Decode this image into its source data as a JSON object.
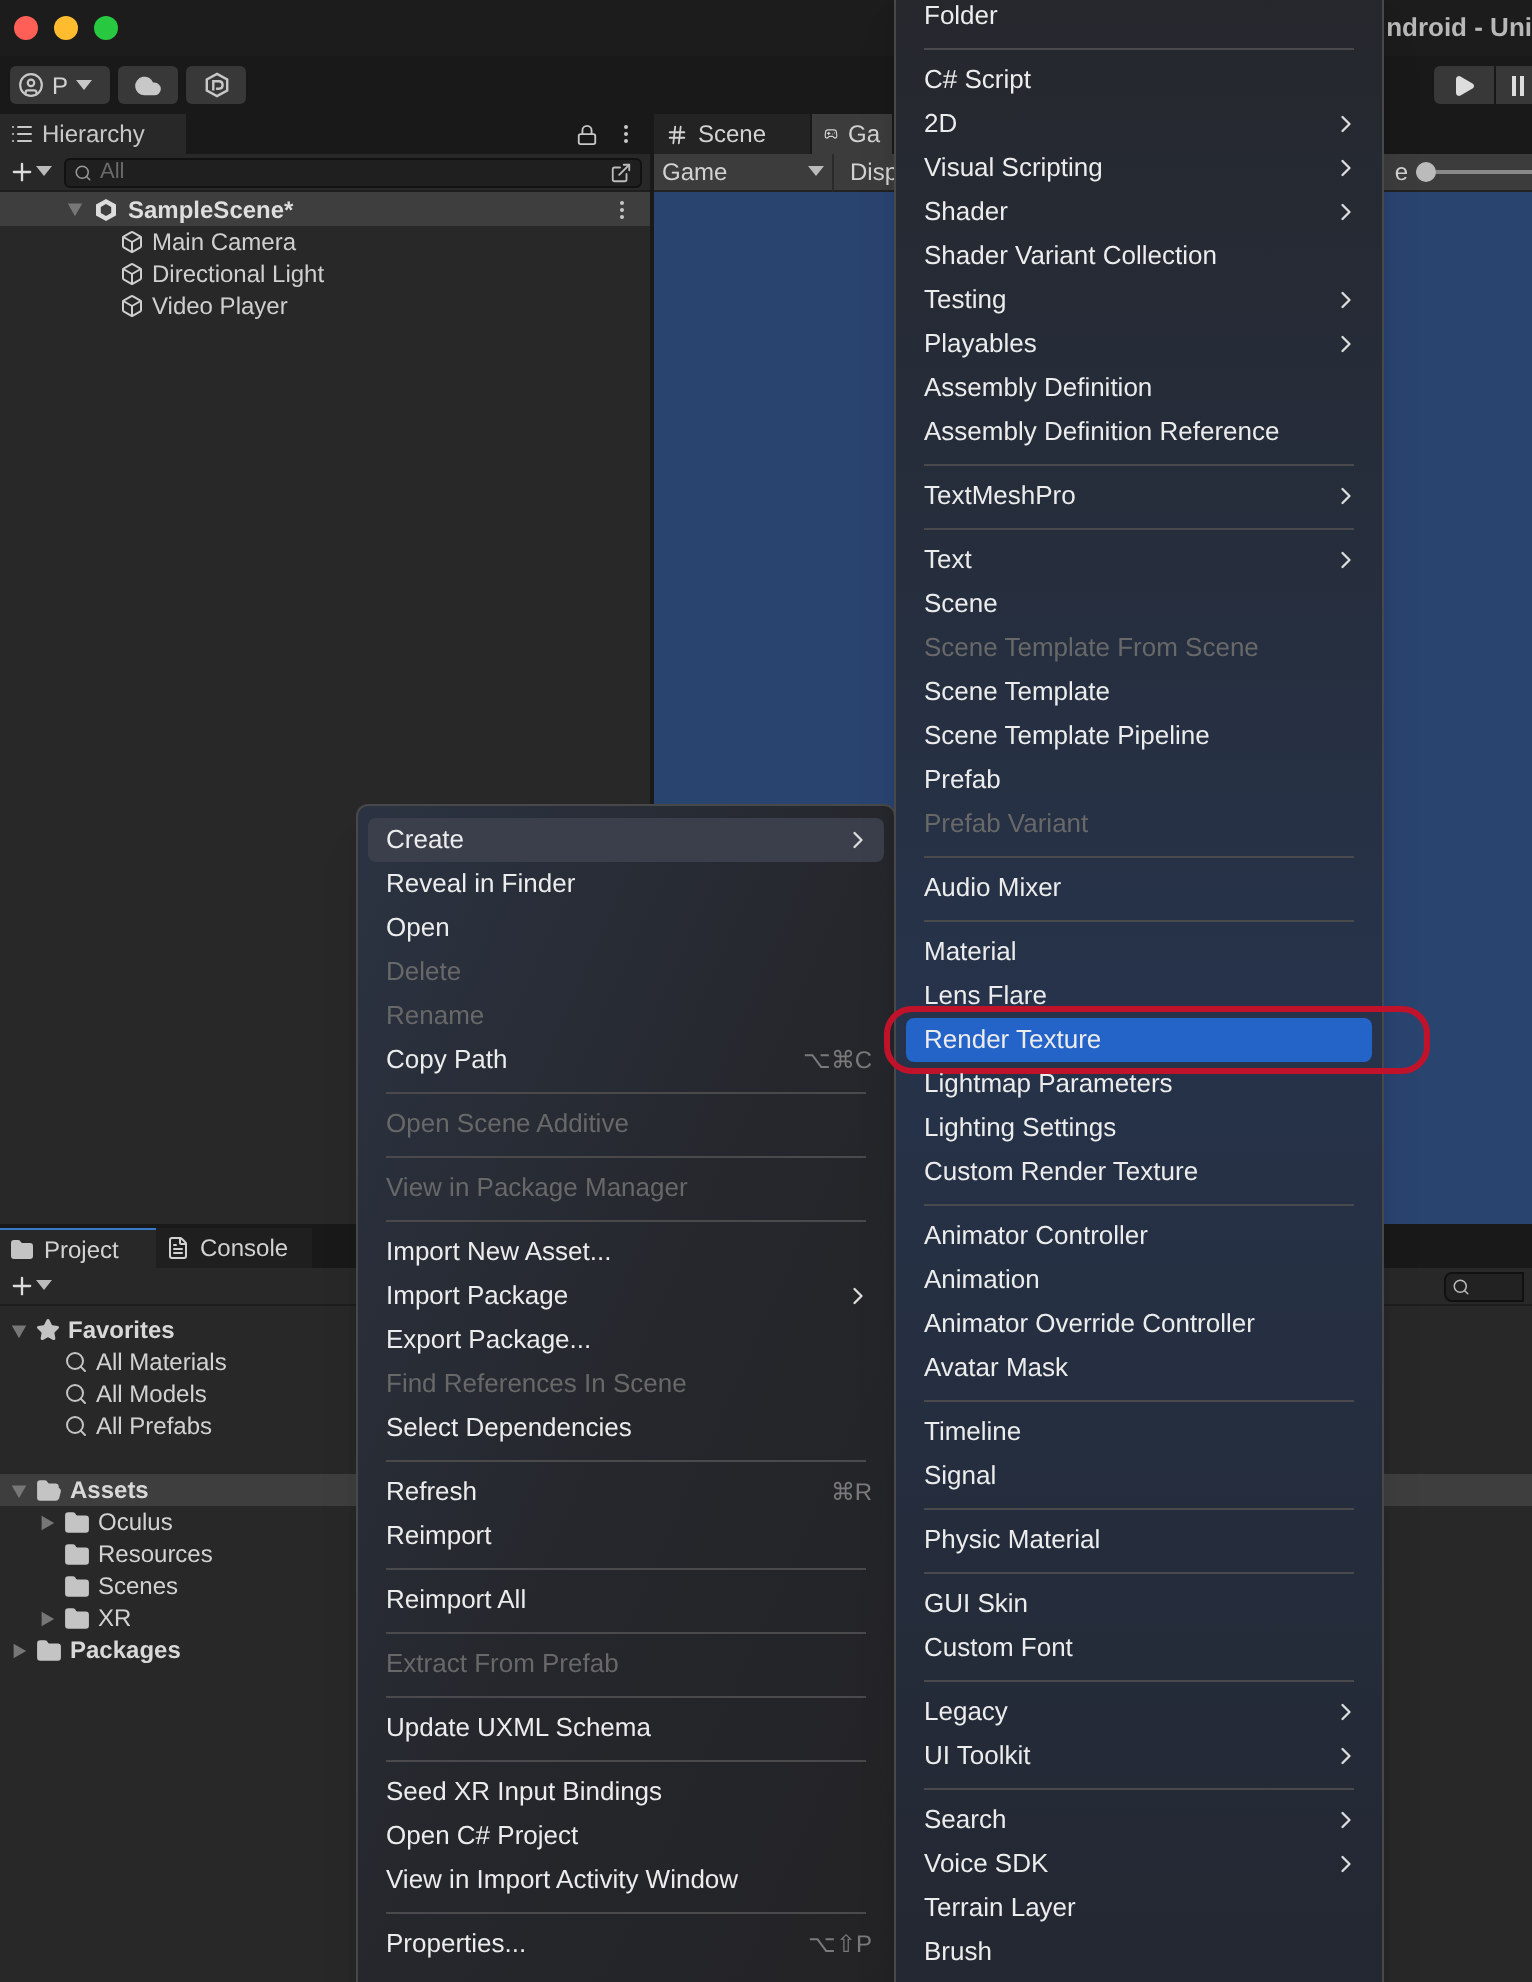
{
  "window": {
    "title": "ndroid - Uni"
  },
  "toolbar": {
    "account": "P"
  },
  "hierarchy": {
    "tab": "Hierarchy",
    "search_placeholder": "All",
    "scene": {
      "label": "SampleScene*",
      "expanded": true,
      "selected": true
    },
    "objects": [
      "Main Camera",
      "Directional Light",
      "Video Player"
    ]
  },
  "view_tabs": [
    {
      "label": "Scene",
      "selected": false
    },
    {
      "label": "Ga",
      "selected": true
    }
  ],
  "view_toolbar": {
    "view": "Game",
    "display": "Disp",
    "scale_label": "e",
    "scale_slider": {
      "level": 0
    }
  },
  "project": {
    "tabs": [
      {
        "label": "Project",
        "selected": true
      },
      {
        "label": "Console",
        "selected": false
      }
    ],
    "tree": [
      {
        "label": "Favorites",
        "kind": "favorites",
        "expanded": true,
        "selected": false,
        "children": [
          {
            "label": "All Materials",
            "kind": "search"
          },
          {
            "label": "All Models",
            "kind": "search"
          },
          {
            "label": "All Prefabs",
            "kind": "search"
          }
        ]
      },
      {
        "label": "Assets",
        "kind": "folder",
        "expanded": true,
        "selected": true,
        "children": [
          {
            "label": "Oculus",
            "kind": "folder",
            "expanded": false
          },
          {
            "label": "Resources",
            "kind": "folder"
          },
          {
            "label": "Scenes",
            "kind": "folder"
          },
          {
            "label": "XR",
            "kind": "folder",
            "expanded": false
          }
        ]
      },
      {
        "label": "Packages",
        "kind": "folder",
        "expanded": false,
        "selected": false
      }
    ]
  },
  "context_menu": [
    {
      "kind": "item",
      "label": "Create",
      "submenu": true,
      "selected": true,
      "disabled": false
    },
    {
      "kind": "item",
      "label": "Reveal in Finder",
      "selected": false,
      "disabled": false
    },
    {
      "kind": "item",
      "label": "Open",
      "selected": false,
      "disabled": false
    },
    {
      "kind": "item",
      "label": "Delete",
      "selected": false,
      "disabled": true
    },
    {
      "kind": "item",
      "label": "Rename",
      "selected": false,
      "disabled": true
    },
    {
      "kind": "item",
      "label": "Copy Path",
      "shortcut": "⌥⌘C",
      "selected": false,
      "disabled": false
    },
    {
      "kind": "separator"
    },
    {
      "kind": "item",
      "label": "Open Scene Additive",
      "selected": false,
      "disabled": true
    },
    {
      "kind": "separator"
    },
    {
      "kind": "item",
      "label": "View in Package Manager",
      "selected": false,
      "disabled": true
    },
    {
      "kind": "separator"
    },
    {
      "kind": "item",
      "label": "Import New Asset...",
      "selected": false,
      "disabled": false
    },
    {
      "kind": "item",
      "label": "Import Package",
      "submenu": true,
      "selected": false,
      "disabled": false
    },
    {
      "kind": "item",
      "label": "Export Package...",
      "selected": false,
      "disabled": false
    },
    {
      "kind": "item",
      "label": "Find References In Scene",
      "selected": false,
      "disabled": true
    },
    {
      "kind": "item",
      "label": "Select Dependencies",
      "selected": false,
      "disabled": false
    },
    {
      "kind": "separator"
    },
    {
      "kind": "item",
      "label": "Refresh",
      "shortcut": "⌘R",
      "selected": false,
      "disabled": false
    },
    {
      "kind": "item",
      "label": "Reimport",
      "selected": false,
      "disabled": false
    },
    {
      "kind": "separator"
    },
    {
      "kind": "item",
      "label": "Reimport All",
      "selected": false,
      "disabled": false
    },
    {
      "kind": "separator"
    },
    {
      "kind": "item",
      "label": "Extract From Prefab",
      "selected": false,
      "disabled": true
    },
    {
      "kind": "separator"
    },
    {
      "kind": "item",
      "label": "Update UXML Schema",
      "selected": false,
      "disabled": false
    },
    {
      "kind": "separator"
    },
    {
      "kind": "item",
      "label": "Seed XR Input Bindings",
      "selected": false,
      "disabled": false
    },
    {
      "kind": "item",
      "label": "Open C# Project",
      "selected": false,
      "disabled": false
    },
    {
      "kind": "item",
      "label": "View in Import Activity Window",
      "selected": false,
      "disabled": false
    },
    {
      "kind": "separator"
    },
    {
      "kind": "item",
      "label": "Properties...",
      "shortcut": "⌥⇧P",
      "selected": false,
      "disabled": false
    }
  ],
  "create_menu": [
    {
      "kind": "item",
      "label": "Folder",
      "selected": false,
      "disabled": false
    },
    {
      "kind": "separator"
    },
    {
      "kind": "item",
      "label": "C# Script",
      "selected": false,
      "disabled": false
    },
    {
      "kind": "item",
      "label": "2D",
      "submenu": true,
      "selected": false,
      "disabled": false
    },
    {
      "kind": "item",
      "label": "Visual Scripting",
      "submenu": true,
      "selected": false,
      "disabled": false
    },
    {
      "kind": "item",
      "label": "Shader",
      "submenu": true,
      "selected": false,
      "disabled": false
    },
    {
      "kind": "item",
      "label": "Shader Variant Collection",
      "selected": false,
      "disabled": false
    },
    {
      "kind": "item",
      "label": "Testing",
      "submenu": true,
      "selected": false,
      "disabled": false
    },
    {
      "kind": "item",
      "label": "Playables",
      "submenu": true,
      "selected": false,
      "disabled": false
    },
    {
      "kind": "item",
      "label": "Assembly Definition",
      "selected": false,
      "disabled": false
    },
    {
      "kind": "item",
      "label": "Assembly Definition Reference",
      "selected": false,
      "disabled": false
    },
    {
      "kind": "separator"
    },
    {
      "kind": "item",
      "label": "TextMeshPro",
      "submenu": true,
      "selected": false,
      "disabled": false
    },
    {
      "kind": "separator"
    },
    {
      "kind": "item",
      "label": "Text",
      "submenu": true,
      "selected": false,
      "disabled": false
    },
    {
      "kind": "item",
      "label": "Scene",
      "selected": false,
      "disabled": false
    },
    {
      "kind": "item",
      "label": "Scene Template From Scene",
      "selected": false,
      "disabled": true
    },
    {
      "kind": "item",
      "label": "Scene Template",
      "selected": false,
      "disabled": false
    },
    {
      "kind": "item",
      "label": "Scene Template Pipeline",
      "selected": false,
      "disabled": false
    },
    {
      "kind": "item",
      "label": "Prefab",
      "selected": false,
      "disabled": false
    },
    {
      "kind": "item",
      "label": "Prefab Variant",
      "selected": false,
      "disabled": true
    },
    {
      "kind": "separator"
    },
    {
      "kind": "item",
      "label": "Audio Mixer",
      "selected": false,
      "disabled": false
    },
    {
      "kind": "separator"
    },
    {
      "kind": "item",
      "label": "Material",
      "selected": false,
      "disabled": false
    },
    {
      "kind": "item",
      "label": "Lens Flare",
      "selected": false,
      "disabled": false
    },
    {
      "kind": "item",
      "label": "Render Texture",
      "selected": true,
      "circled": true,
      "disabled": false
    },
    {
      "kind": "item",
      "label": "Lightmap Parameters",
      "selected": false,
      "disabled": false
    },
    {
      "kind": "item",
      "label": "Lighting Settings",
      "selected": false,
      "disabled": false
    },
    {
      "kind": "item",
      "label": "Custom Render Texture",
      "selected": false,
      "disabled": false
    },
    {
      "kind": "separator"
    },
    {
      "kind": "item",
      "label": "Animator Controller",
      "selected": false,
      "disabled": false
    },
    {
      "kind": "item",
      "label": "Animation",
      "selected": false,
      "disabled": false
    },
    {
      "kind": "item",
      "label": "Animator Override Controller",
      "selected": false,
      "disabled": false
    },
    {
      "kind": "item",
      "label": "Avatar Mask",
      "selected": false,
      "disabled": false
    },
    {
      "kind": "separator"
    },
    {
      "kind": "item",
      "label": "Timeline",
      "selected": false,
      "disabled": false
    },
    {
      "kind": "item",
      "label": "Signal",
      "selected": false,
      "disabled": false
    },
    {
      "kind": "separator"
    },
    {
      "kind": "item",
      "label": "Physic Material",
      "selected": false,
      "disabled": false
    },
    {
      "kind": "separator"
    },
    {
      "kind": "item",
      "label": "GUI Skin",
      "selected": false,
      "disabled": false
    },
    {
      "kind": "item",
      "label": "Custom Font",
      "selected": false,
      "disabled": false
    },
    {
      "kind": "separator"
    },
    {
      "kind": "item",
      "label": "Legacy",
      "submenu": true,
      "selected": false,
      "disabled": false
    },
    {
      "kind": "item",
      "label": "UI Toolkit",
      "submenu": true,
      "selected": false,
      "disabled": false
    },
    {
      "kind": "separator"
    },
    {
      "kind": "item",
      "label": "Search",
      "submenu": true,
      "selected": false,
      "disabled": false
    },
    {
      "kind": "item",
      "label": "Voice SDK",
      "submenu": true,
      "selected": false,
      "disabled": false
    },
    {
      "kind": "item",
      "label": "Terrain Layer",
      "selected": false,
      "disabled": false
    },
    {
      "kind": "item",
      "label": "Brush",
      "selected": false,
      "disabled": false
    }
  ]
}
